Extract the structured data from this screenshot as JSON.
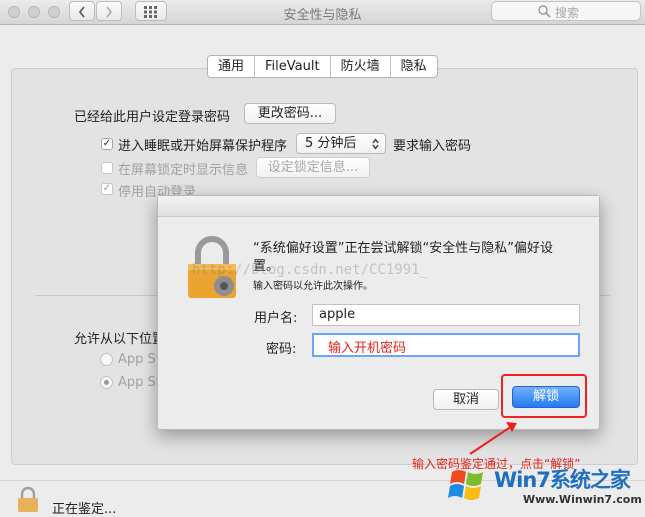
{
  "window": {
    "title": "安全性与隐私"
  },
  "toolbar": {
    "search_placeholder": "搜索"
  },
  "tabs": [
    {
      "label": "通用",
      "selected": true
    },
    {
      "label": "FileVault",
      "selected": false
    },
    {
      "label": "防火墙",
      "selected": false
    },
    {
      "label": "隐私",
      "selected": false
    }
  ],
  "general": {
    "login_password_label": "已经给此用户设定登录密码",
    "change_password_button": "更改密码...",
    "sleep_screensaver": {
      "label": "进入睡眠或开始屏幕保护程序",
      "checked": true
    },
    "delay_select": {
      "value": "5 分钟后"
    },
    "require_password_suffix": "要求输入密码",
    "lock_message": {
      "label": "在屏幕锁定时显示信息",
      "checked": false,
      "disabled": true
    },
    "set_lock_message_button": "设定锁定信息...",
    "disable_auto_login": {
      "label": "停用自动登录",
      "checked": true,
      "disabled": true
    },
    "allow_apps_label": "允许从以下位置",
    "allow_options": [
      {
        "label": "App St",
        "selected": false
      },
      {
        "label": "App St",
        "selected": true
      }
    ]
  },
  "dialog": {
    "title_line1": "“系统偏好设置”正在尝试解锁“安全性与隐私”偏好设",
    "title_line2": "置。",
    "subtitle": "输入密码以允许此次操作。",
    "username_label": "用户名:",
    "username_value": "apple",
    "password_label": "密码:",
    "password_hint": "输入开机密码",
    "cancel_button": "取消",
    "unlock_button": "解锁"
  },
  "watermark": "http://blog.csdn.net/CC1991_",
  "annotation": {
    "text": "输入密码鉴定通过，点击“解锁”",
    "color": "#e5231b"
  },
  "footer": {
    "status": "正在鉴定..."
  },
  "brand": {
    "name": "Win7系统之家",
    "url": "Www.Winwin7.com"
  },
  "colors": {
    "accent": "#2679f2",
    "annotation": "#e5231b"
  }
}
